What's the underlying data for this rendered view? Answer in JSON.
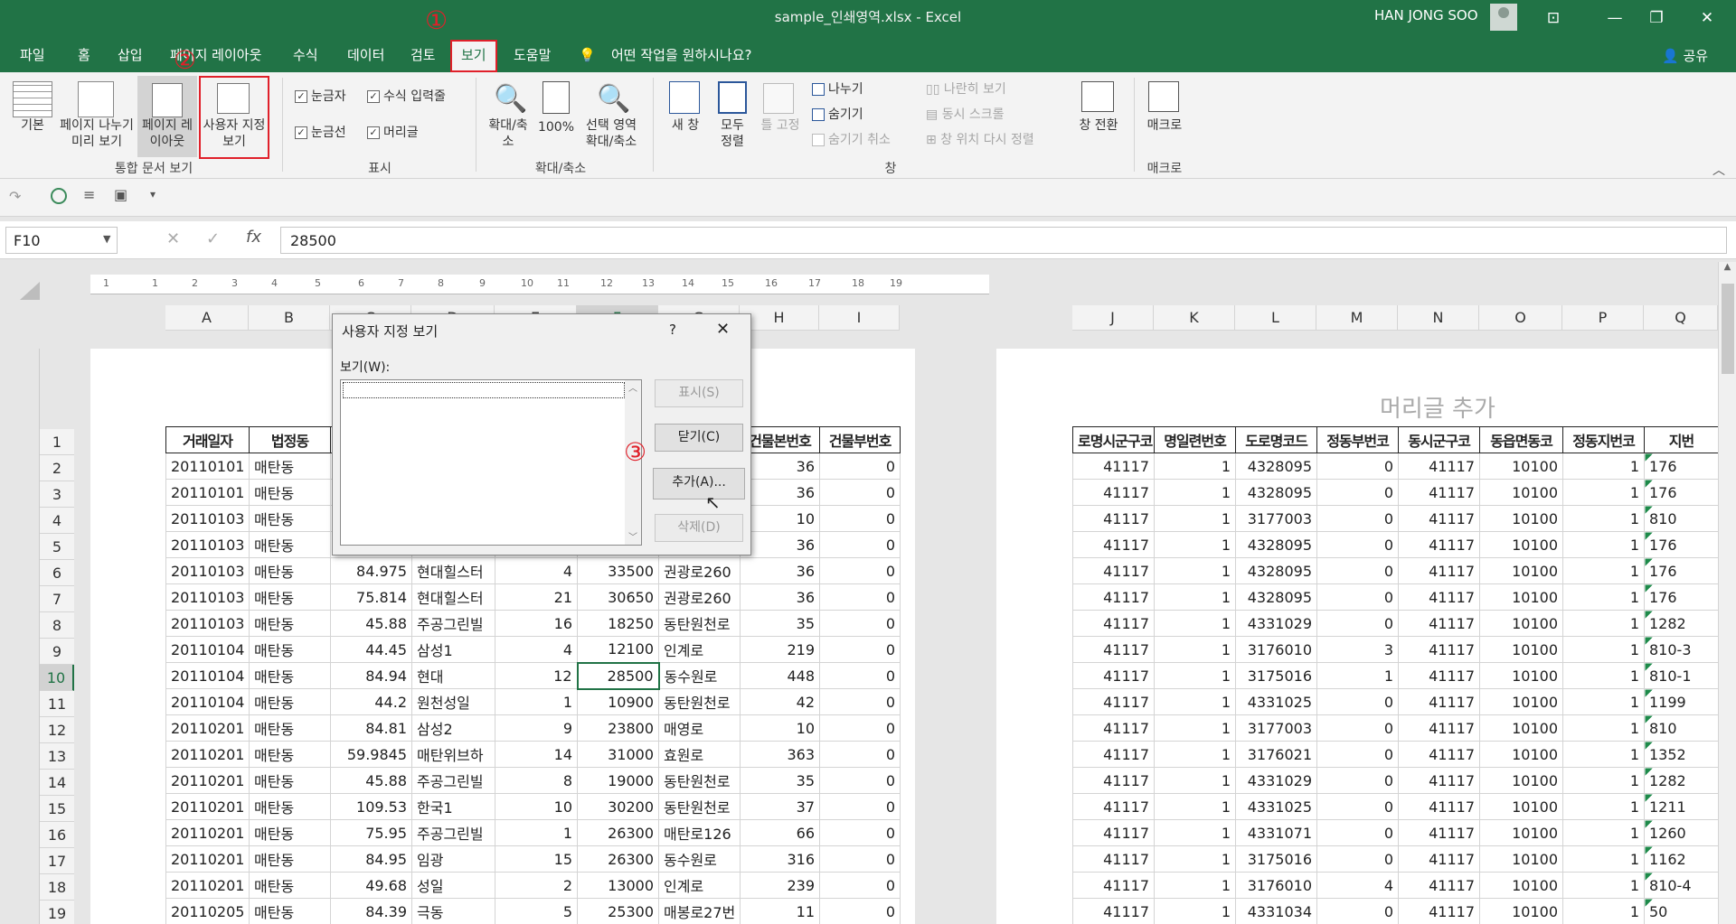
{
  "window": {
    "title": "sample_인쇄영역.xlsx  -  Excel",
    "user": "HAN JONG SOO",
    "share": "공유"
  },
  "tabs": [
    "파일",
    "홈",
    "삽입",
    "페이지 레이아웃",
    "수식",
    "데이터",
    "검토",
    "보기",
    "도움말"
  ],
  "active_tab": "보기",
  "tell_me": "어떤 작업을 원하시나요?",
  "annotations": [
    "①",
    "②",
    "③"
  ],
  "ribbon": {
    "views": {
      "normal": "기본",
      "page_break": "페이지 나누기 미리 보기",
      "page_layout": "페이지 레이아웃",
      "custom": "사용자 지정 보기",
      "label": "통합 문서 보기"
    },
    "show": {
      "ruler": "눈금자",
      "formula_bar": "수식 입력줄",
      "gridlines": "눈금선",
      "headings": "머리글",
      "label": "표시"
    },
    "zoom": {
      "zoom": "확대/축소",
      "hundred": "100%",
      "selection": "선택 영역 확대/축소",
      "label": "확대/축소"
    },
    "window": {
      "new": "새 창",
      "arrange": "모두 정렬",
      "freeze": "틀 고정",
      "split": "나누기",
      "hide": "숨기기",
      "unhide": "숨기기 취소",
      "side": "나란히 보기",
      "sync": "동시 스크롤",
      "reset": "창 위치 다시 정렬",
      "switch": "창 전환",
      "label": "창"
    },
    "macro": {
      "macro": "매크로",
      "label": "매크로"
    }
  },
  "namebox": "F10",
  "formula": "28500",
  "header_placeholder": "머리글 추가",
  "ruler_nums": [
    "1",
    "1",
    "2",
    "3",
    "4",
    "5",
    "6",
    "7",
    "8",
    "9",
    "10",
    "11",
    "12",
    "13",
    "14",
    "15",
    "16",
    "17",
    "18",
    "19"
  ],
  "left_cols": [
    "A",
    "B",
    "C",
    "D",
    "E",
    "F",
    "G",
    "H",
    "I"
  ],
  "right_cols": [
    "J",
    "K",
    "L",
    "M",
    "N",
    "O",
    "P",
    "Q"
  ],
  "rows": [
    "1",
    "2",
    "3",
    "4",
    "5",
    "6",
    "7",
    "8",
    "9",
    "10",
    "11",
    "12",
    "13",
    "14",
    "15",
    "16",
    "17",
    "18",
    "19"
  ],
  "left_header": [
    "거래일자",
    "법정동",
    "",
    "",
    "",
    "",
    "",
    "건물본번호",
    "건물부번호"
  ],
  "left_data": [
    [
      "20110101",
      "매탄동",
      "",
      "",
      "",
      "",
      "",
      "36",
      "0"
    ],
    [
      "20110101",
      "매탄동",
      "",
      "",
      "",
      "",
      "",
      "36",
      "0"
    ],
    [
      "20110103",
      "매탄동",
      "",
      "",
      "",
      "",
      "",
      "10",
      "0"
    ],
    [
      "20110103",
      "매탄동",
      "",
      "",
      "",
      "",
      "",
      "36",
      "0"
    ],
    [
      "20110103",
      "매탄동",
      "84.975",
      "현대힐스터",
      "4",
      "33500",
      "권광로260",
      "36",
      "0"
    ],
    [
      "20110103",
      "매탄동",
      "75.814",
      "현대힐스터",
      "21",
      "30650",
      "권광로260",
      "36",
      "0"
    ],
    [
      "20110103",
      "매탄동",
      "45.88",
      "주공그린빌",
      "16",
      "18250",
      "동탄원천로",
      "35",
      "0"
    ],
    [
      "20110104",
      "매탄동",
      "44.45",
      "삼성1",
      "4",
      "12100",
      "인계로",
      "219",
      "0"
    ],
    [
      "20110104",
      "매탄동",
      "84.94",
      "현대",
      "12",
      "28500",
      "동수원로",
      "448",
      "0"
    ],
    [
      "20110104",
      "매탄동",
      "44.2",
      "원천성일",
      "1",
      "10900",
      "동탄원천로",
      "42",
      "0"
    ],
    [
      "20110201",
      "매탄동",
      "84.81",
      "삼성2",
      "9",
      "23800",
      "매영로",
      "10",
      "0"
    ],
    [
      "20110201",
      "매탄동",
      "59.9845",
      "매탄위브하",
      "14",
      "31000",
      "효원로",
      "363",
      "0"
    ],
    [
      "20110201",
      "매탄동",
      "45.88",
      "주공그린빌",
      "8",
      "19000",
      "동탄원천로",
      "35",
      "0"
    ],
    [
      "20110201",
      "매탄동",
      "109.53",
      "한국1",
      "10",
      "30200",
      "동탄원천로",
      "37",
      "0"
    ],
    [
      "20110201",
      "매탄동",
      "75.95",
      "주공그린빌",
      "1",
      "26300",
      "매탄로126",
      "66",
      "0"
    ],
    [
      "20110201",
      "매탄동",
      "84.95",
      "임광",
      "15",
      "26300",
      "동수원로",
      "316",
      "0"
    ],
    [
      "20110201",
      "매탄동",
      "49.68",
      "성일",
      "2",
      "13000",
      "인계로",
      "239",
      "0"
    ],
    [
      "20110205",
      "매탄동",
      "84.39",
      "극동",
      "5",
      "25300",
      "매봉로27번",
      "11",
      "0"
    ]
  ],
  "right_header": [
    "로명시군구코",
    "명일련번호",
    "도로명코드",
    "정동부번코",
    "동시군구코",
    "동읍면동코",
    "정동지번코",
    "지번"
  ],
  "right_data": [
    [
      "41117",
      "1",
      "4328095",
      "0",
      "41117",
      "10100",
      "1",
      "176"
    ],
    [
      "41117",
      "1",
      "4328095",
      "0",
      "41117",
      "10100",
      "1",
      "176"
    ],
    [
      "41117",
      "1",
      "3177003",
      "0",
      "41117",
      "10100",
      "1",
      "810"
    ],
    [
      "41117",
      "1",
      "4328095",
      "0",
      "41117",
      "10100",
      "1",
      "176"
    ],
    [
      "41117",
      "1",
      "4328095",
      "0",
      "41117",
      "10100",
      "1",
      "176"
    ],
    [
      "41117",
      "1",
      "4328095",
      "0",
      "41117",
      "10100",
      "1",
      "176"
    ],
    [
      "41117",
      "1",
      "4331029",
      "0",
      "41117",
      "10100",
      "1",
      "1282"
    ],
    [
      "41117",
      "1",
      "3176010",
      "3",
      "41117",
      "10100",
      "1",
      "810-3"
    ],
    [
      "41117",
      "1",
      "3175016",
      "1",
      "41117",
      "10100",
      "1",
      "810-1"
    ],
    [
      "41117",
      "1",
      "4331025",
      "0",
      "41117",
      "10100",
      "1",
      "1199"
    ],
    [
      "41117",
      "1",
      "3177003",
      "0",
      "41117",
      "10100",
      "1",
      "810"
    ],
    [
      "41117",
      "1",
      "3176021",
      "0",
      "41117",
      "10100",
      "1",
      "1352"
    ],
    [
      "41117",
      "1",
      "4331029",
      "0",
      "41117",
      "10100",
      "1",
      "1282"
    ],
    [
      "41117",
      "1",
      "4331025",
      "0",
      "41117",
      "10100",
      "1",
      "1211"
    ],
    [
      "41117",
      "1",
      "4331071",
      "0",
      "41117",
      "10100",
      "1",
      "1260"
    ],
    [
      "41117",
      "1",
      "3175016",
      "0",
      "41117",
      "10100",
      "1",
      "1162"
    ],
    [
      "41117",
      "1",
      "3176010",
      "4",
      "41117",
      "10100",
      "1",
      "810-4"
    ],
    [
      "41117",
      "1",
      "4331034",
      "0",
      "41117",
      "10100",
      "1",
      "50"
    ]
  ],
  "dialog": {
    "title": "사용자 지정 보기",
    "help": "?",
    "close": "✕",
    "list_label": "보기(W):",
    "show": "표시(S)",
    "close_btn": "닫기(C)",
    "add": "추가(A)...",
    "delete": "삭제(D)"
  }
}
